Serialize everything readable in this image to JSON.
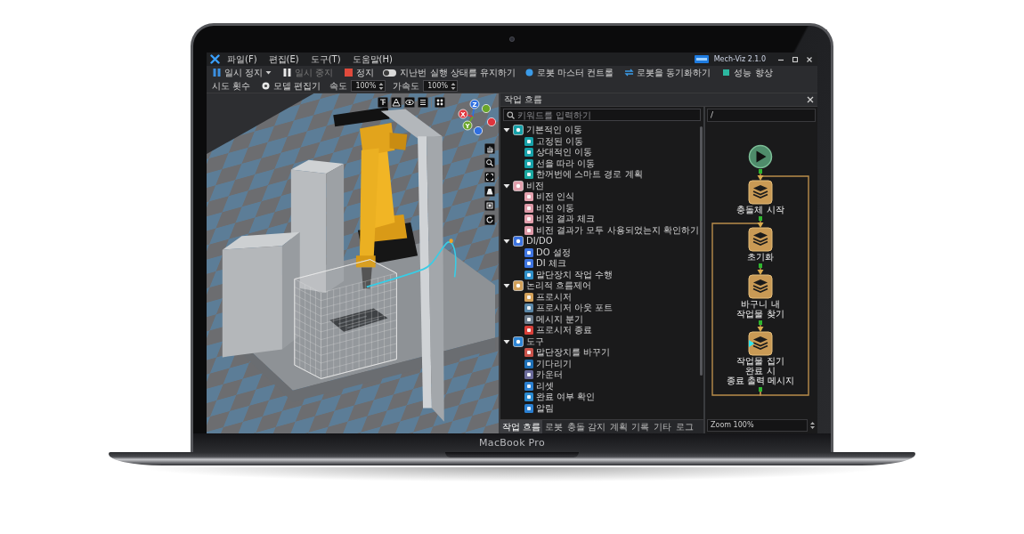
{
  "menu": [
    "파일(F)",
    "편집(E)",
    "도구(T)",
    "도움말(H)"
  ],
  "app_name": "Mech-Viz 2.1.0",
  "toolbar": [
    {
      "kind": "button",
      "label": "일시 정지",
      "disabled": false,
      "has_menu": true
    },
    {
      "kind": "button",
      "label": "일시 중지",
      "disabled": true,
      "has_menu": false
    },
    {
      "kind": "button",
      "label": "정지",
      "disabled": false,
      "has_menu": false
    },
    {
      "kind": "toggle",
      "label": "지난번 실행 상태를 유지하기",
      "disabled": false,
      "on": false
    },
    {
      "kind": "button",
      "label": "로봇 마스터 컨트롤",
      "disabled": false,
      "has_menu": false
    },
    {
      "kind": "button",
      "label": "로봇을 동기화하기",
      "disabled": false,
      "has_menu": false
    },
    {
      "kind": "button",
      "label": "성능 향상",
      "disabled": false,
      "has_menu": false
    },
    {
      "kind": "button",
      "label": "시도 횟수",
      "disabled": false,
      "has_menu": false
    },
    {
      "kind": "button",
      "label": "모델 편집기",
      "disabled": false,
      "has_menu": false
    },
    {
      "kind": "spin",
      "label": "속도",
      "value": "100%",
      "disabled": false
    },
    {
      "kind": "spin",
      "label": "가속도",
      "value": "100%",
      "disabled": false
    }
  ],
  "viewport": {
    "axis_labels": [
      "Z",
      "X",
      "Y"
    ]
  },
  "panel": {
    "title": "작업 흐름",
    "search": {
      "placeholder": "키워드를 입력하기"
    },
    "tree": [
      {
        "label": "기본적인 이동",
        "expanded": true,
        "children": [
          {
            "label": "고정된 이동"
          },
          {
            "label": "상대적인 이동"
          },
          {
            "label": "선을 따라 이동"
          },
          {
            "label": "한꺼번에 스마트 경로 계획"
          }
        ]
      },
      {
        "label": "비전",
        "expanded": true,
        "children": [
          {
            "label": "비전 인식"
          },
          {
            "label": "비전 이동"
          },
          {
            "label": "비전 결과 체크"
          },
          {
            "label": "비전 결과가 모두 사용되었는지 확인하기"
          }
        ]
      },
      {
        "label": "DI/DO",
        "expanded": true,
        "children": [
          {
            "label": "DO 설정"
          },
          {
            "label": "DI 체크"
          },
          {
            "label": "말단장치 작업 수행"
          }
        ]
      },
      {
        "label": "논리적 흐름제어",
        "expanded": true,
        "children": [
          {
            "label": "프로시저"
          },
          {
            "label": "프로시저 아웃 포트"
          },
          {
            "label": "메시지 분기"
          },
          {
            "label": "프로시저 종료"
          }
        ]
      },
      {
        "label": "도구",
        "expanded": true,
        "children": [
          {
            "label": "말단장치를 바꾸기"
          },
          {
            "label": "기다리기"
          },
          {
            "label": "카운터"
          },
          {
            "label": "리셋"
          },
          {
            "label": "완료 여부 확인"
          },
          {
            "label": "알림"
          }
        ]
      }
    ],
    "tabs": [
      {
        "label": "작업 흐름",
        "selected": true
      },
      {
        "label": "로봇",
        "selected": false
      },
      {
        "label": "충돌 감지",
        "selected": false
      },
      {
        "label": "계획 기록",
        "selected": false
      },
      {
        "label": "기타",
        "selected": false
      },
      {
        "label": "로그",
        "selected": false
      }
    ],
    "flow": {
      "path": "/",
      "nodes": [
        {
          "kind": "start",
          "current": false
        },
        {
          "kind": "step",
          "label_lines": [
            "충돌체 시작"
          ],
          "current": false,
          "loop_in": true
        },
        {
          "kind": "step",
          "label_lines": [
            "초기화"
          ],
          "current": false,
          "loop_in": true
        },
        {
          "kind": "step",
          "label_lines": [
            "바구니 내",
            "작업물 찾기"
          ],
          "current": false,
          "loop_in": false
        },
        {
          "kind": "step",
          "label_lines": [
            "작업물 집기",
            "완료 시",
            "종료 출력 메시지"
          ],
          "current": true,
          "loop_in": false
        }
      ],
      "zoom": "Zoom 100%"
    }
  },
  "device": {
    "label": "MacBook Pro"
  }
}
